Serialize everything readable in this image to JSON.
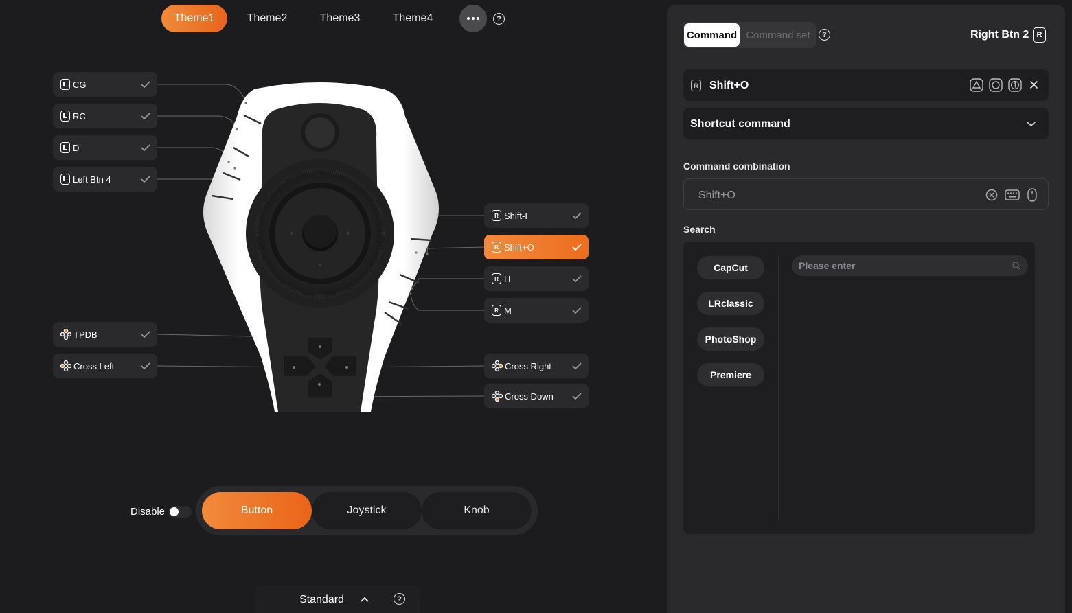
{
  "themes": [
    {
      "label": "Theme1",
      "active": true
    },
    {
      "label": "Theme2",
      "active": false
    },
    {
      "label": "Theme3",
      "active": false
    },
    {
      "label": "Theme4",
      "active": false
    }
  ],
  "left_buttons": [
    {
      "badge": "L",
      "label": "CG"
    },
    {
      "badge": "L",
      "label": "RC"
    },
    {
      "badge": "L",
      "label": "D"
    },
    {
      "badge": "L",
      "label": "Left Btn 4"
    },
    {
      "badge": "cross",
      "label": "TPDB"
    },
    {
      "badge": "cross",
      "label": "Cross Left"
    }
  ],
  "right_buttons": [
    {
      "badge": "R",
      "label": "Shift-I",
      "active": false
    },
    {
      "badge": "R",
      "label": "Shift+O",
      "active": true
    },
    {
      "badge": "R",
      "label": "H",
      "active": false
    },
    {
      "badge": "R",
      "label": "M",
      "active": false
    },
    {
      "badge": "cross",
      "label": "Cross Right",
      "active": false
    },
    {
      "badge": "cross",
      "label": "Cross Down",
      "active": false
    }
  ],
  "mode": {
    "disable_label": "Disable",
    "buttons": [
      "Button",
      "Joystick",
      "Knob"
    ],
    "active": "Button"
  },
  "standard_label": "Standard",
  "panel": {
    "tab_command": "Command",
    "tab_command_set": "Command set",
    "button_title": "Right Btn 2",
    "button_badge": "R",
    "shortcut_badge": "R",
    "shortcut_value": "Shift+O",
    "command_type": "Shortcut command",
    "combination_label": "Command combination",
    "combination_value": "Shift+O",
    "search_label": "Search",
    "search_placeholder": "Please enter",
    "apps": [
      "CapCut",
      "LRclassic",
      "PhotoShop",
      "Premiere"
    ]
  },
  "colors": {
    "accent": "#ef7a2a",
    "background": "#1c1c1e",
    "panel": "#2a2a2c"
  }
}
